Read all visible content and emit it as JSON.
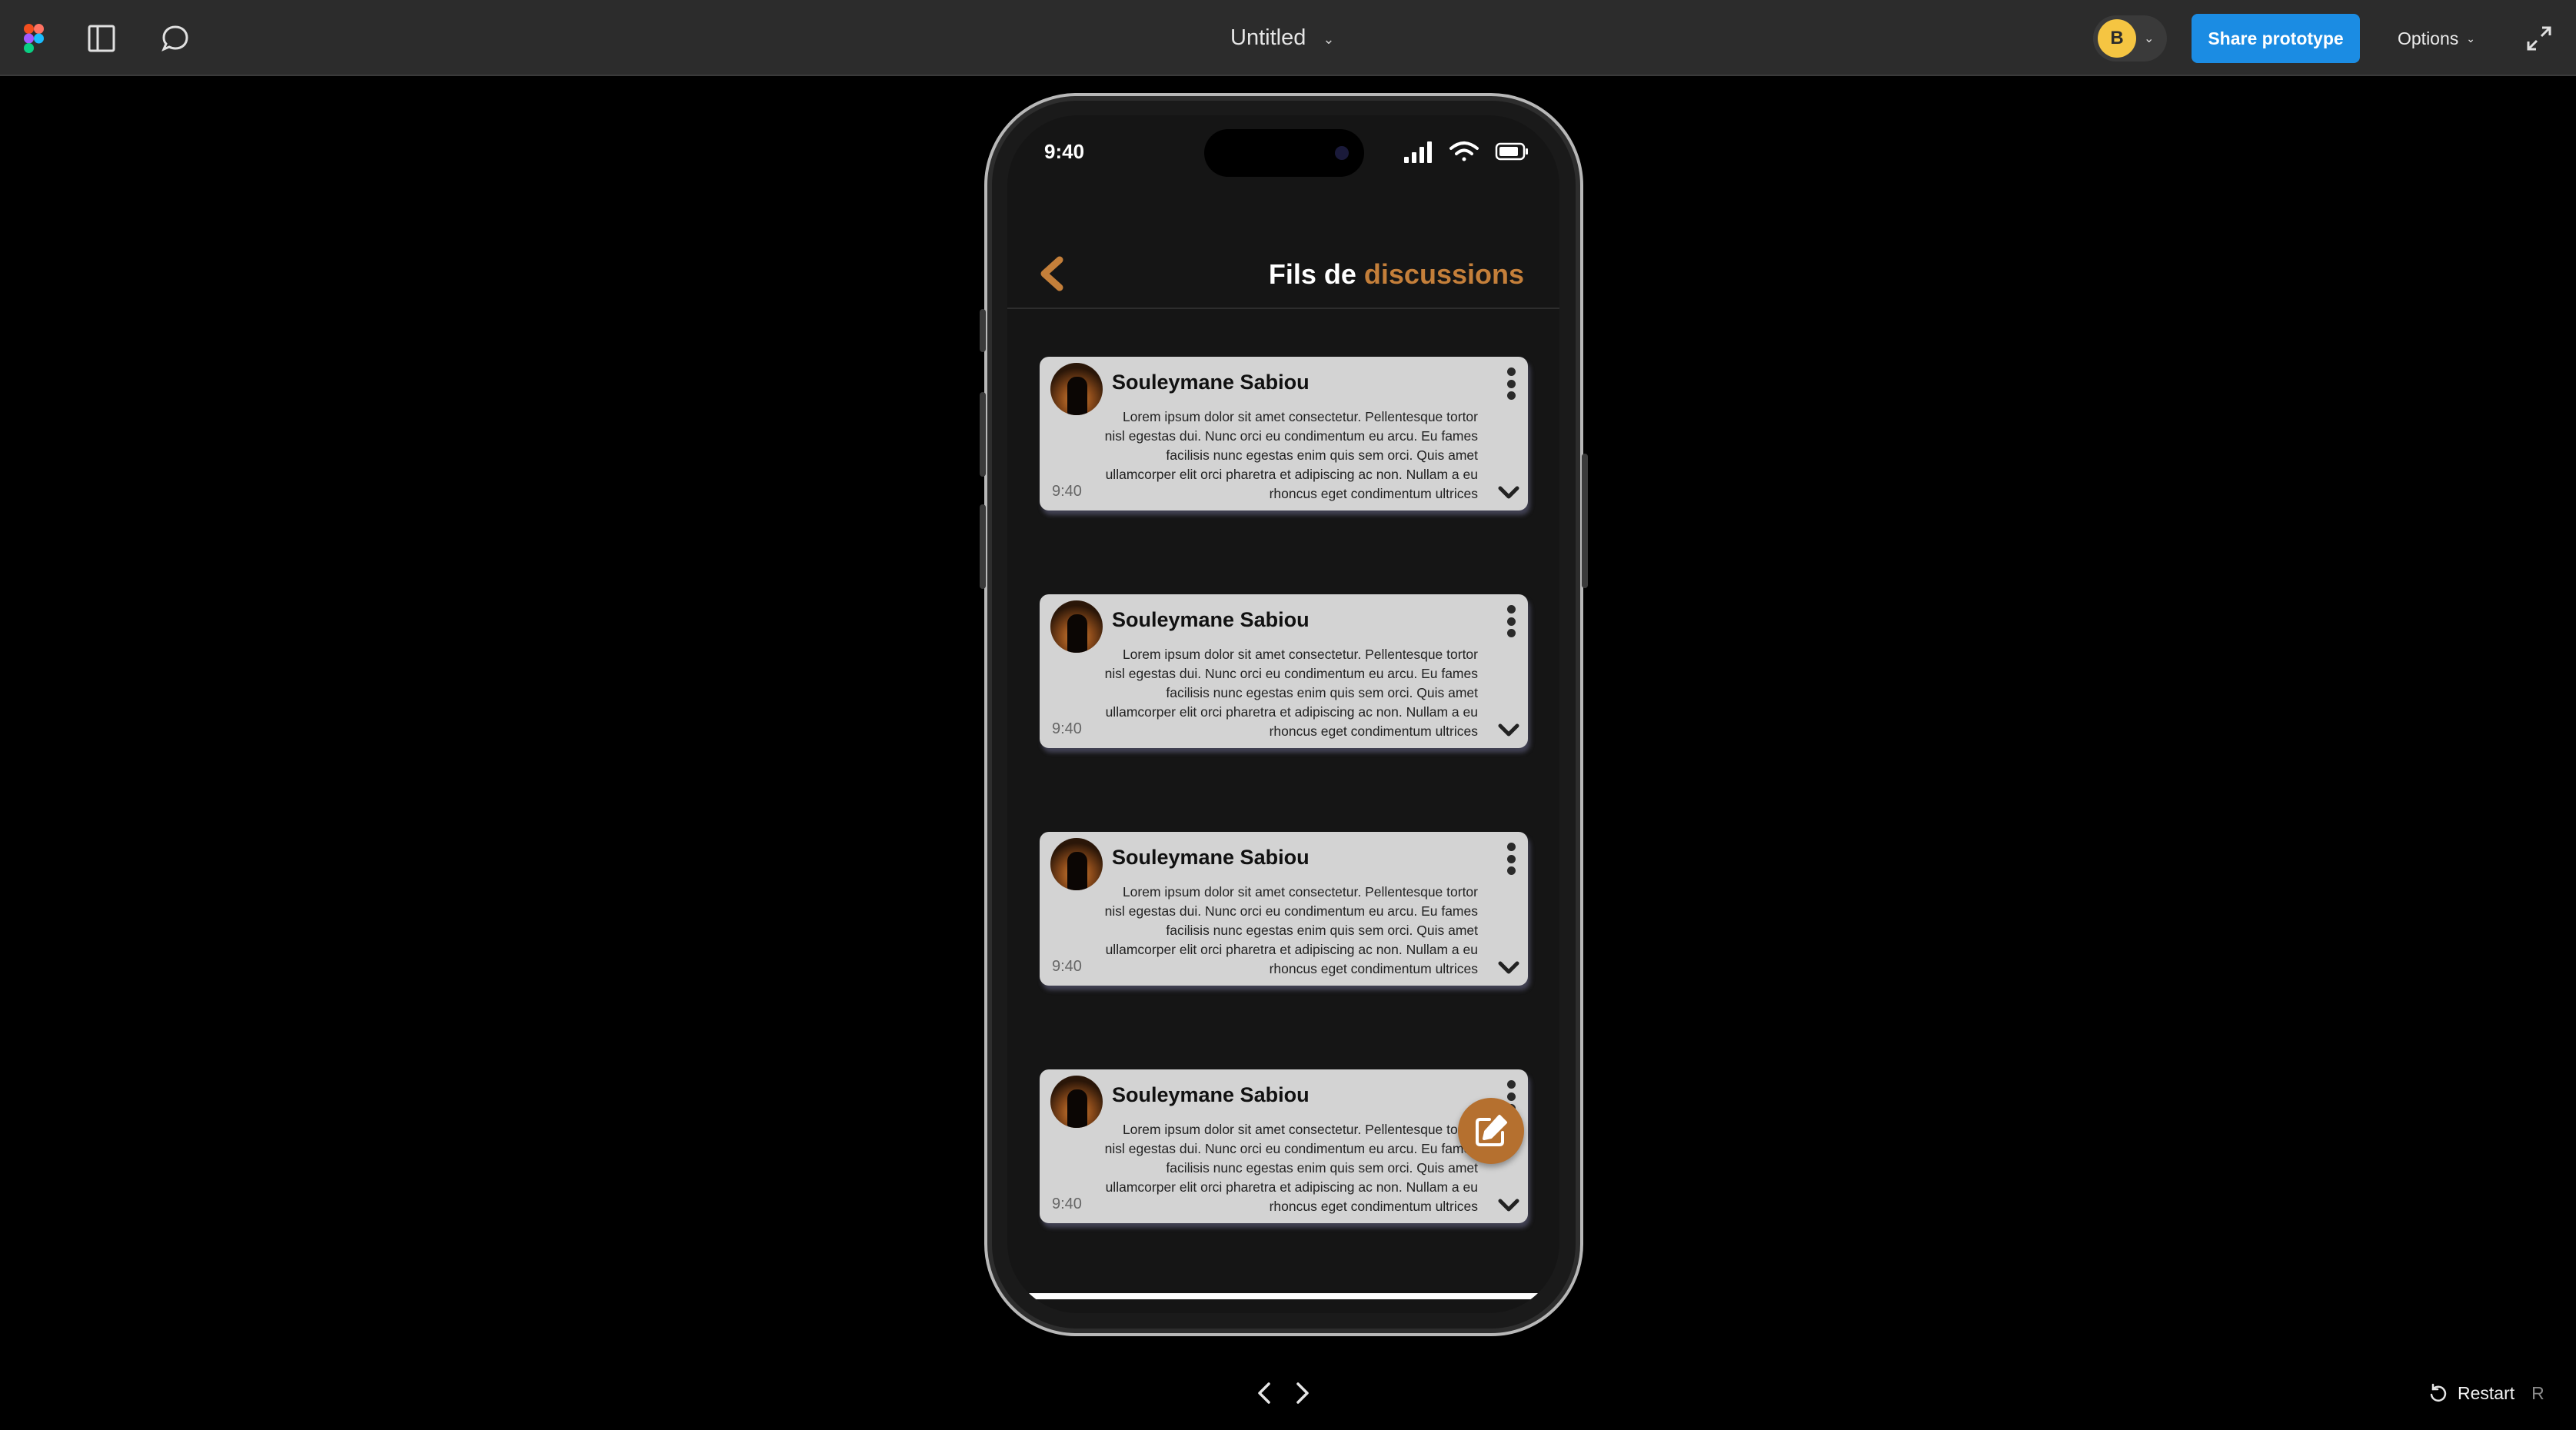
{
  "toolbar": {
    "document_title": "Untitled",
    "user_initial": "B",
    "share_label": "Share prototype",
    "options_label": "Options",
    "icons": [
      "figma-logo",
      "panel-icon",
      "comment-icon",
      "expand-icon"
    ]
  },
  "phone": {
    "status_time": "9:40",
    "status_icons": [
      "cellular-signal-icon",
      "wifi-icon",
      "battery-icon"
    ],
    "header": {
      "title_part1": "Fils de",
      "title_part2": "discussions"
    },
    "accent_color": "#c47f3a",
    "threads": [
      {
        "name": "Souleymane Sabiou",
        "time": "9:40",
        "body": "Lorem ipsum dolor sit amet consectetur. Pellentesque tortor nisl egestas dui. Nunc orci eu condimentum eu arcu. Eu fames facilisis nunc egestas enim quis sem orci. Quis amet ullamcorper elit orci pharetra et adipiscing ac non. Nullam a eu rhoncus eget condimentum ultrices"
      },
      {
        "name": "Souleymane Sabiou",
        "time": "9:40",
        "body": "Lorem ipsum dolor sit amet consectetur. Pellentesque tortor nisl egestas dui. Nunc orci eu condimentum eu arcu. Eu fames facilisis nunc egestas enim quis sem orci. Quis amet ullamcorper elit orci pharetra et adipiscing ac non. Nullam a eu rhoncus eget condimentum ultrices"
      },
      {
        "name": "Souleymane Sabiou",
        "time": "9:40",
        "body": "Lorem ipsum dolor sit amet consectetur. Pellentesque tortor nisl egestas dui. Nunc orci eu condimentum eu arcu. Eu fames facilisis nunc egestas enim quis sem orci. Quis amet ullamcorper elit orci pharetra et adipiscing ac non. Nullam a eu rhoncus eget condimentum ultrices"
      },
      {
        "name": "Souleymane Sabiou",
        "time": "9:40",
        "body": "Lorem ipsum dolor sit amet consectetur. Pellentesque tortor nisl egestas dui. Nunc orci eu condimentum eu arcu. Eu fames facilisis nunc egestas enim quis sem orci. Quis amet ullamcorper elit orci pharetra et adipiscing ac non. Nullam a eu rhoncus eget condimentum ultrices"
      }
    ],
    "fab_icon": "edit-icon"
  },
  "footer": {
    "restart_label": "Restart",
    "restart_key": "R"
  }
}
